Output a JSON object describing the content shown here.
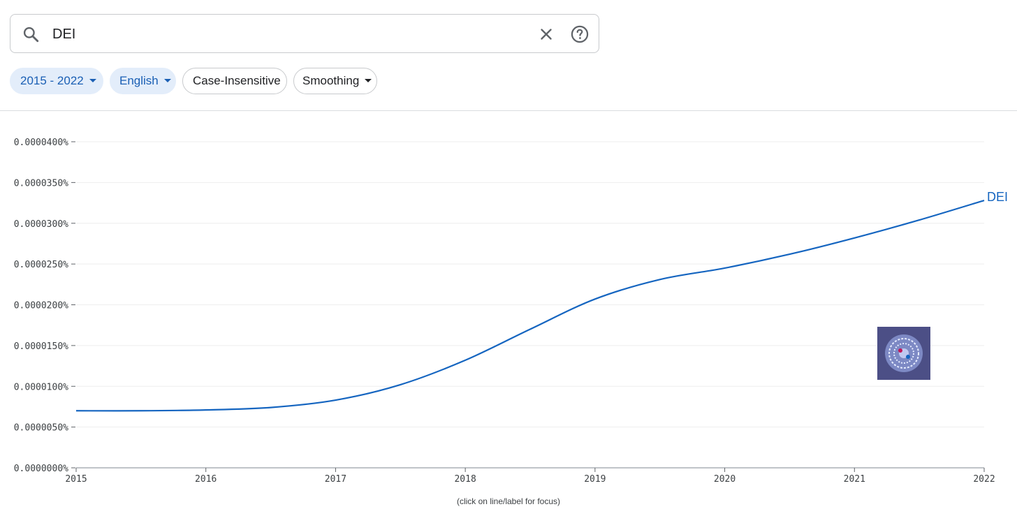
{
  "search": {
    "query": "DEI",
    "icon": "search-icon",
    "clear_icon": "close-icon",
    "help_icon": "help-circle-icon"
  },
  "filters": {
    "year_range": "2015 - 2022",
    "language": "English",
    "case": "Case-Insensitive",
    "smoothing": "Smoothing"
  },
  "colors": {
    "series": "#1565c0",
    "chip_active_bg": "#e3edfa",
    "chip_active_text": "#1a5fb4"
  },
  "footnote": "(click on line/label for focus)",
  "chart_data": {
    "type": "line",
    "x": [
      2015,
      2015.5,
      2016,
      2016.5,
      2017,
      2017.5,
      2018,
      2018.5,
      2019,
      2019.5,
      2020,
      2020.5,
      2021,
      2021.5,
      2022
    ],
    "series": [
      {
        "name": "DEI",
        "values": [
          7e-06,
          7e-06,
          7.1e-06,
          7.4e-06,
          8.3e-06,
          1.02e-05,
          1.32e-05,
          1.7e-05,
          2.07e-05,
          2.31e-05,
          2.45e-05,
          2.62e-05,
          2.82e-05,
          3.04e-05,
          3.28e-05
        ]
      }
    ],
    "xticks": [
      "2015",
      "2016",
      "2017",
      "2018",
      "2019",
      "2020",
      "2021",
      "2022"
    ],
    "yticks": [
      "0.0000000%",
      "0.0000050%",
      "0.0000100%",
      "0.0000150%",
      "0.0000200%",
      "0.0000250%",
      "0.0000300%",
      "0.0000350%",
      "0.0000400%"
    ],
    "ylim": [
      0,
      4e-05
    ],
    "xlim": [
      2015,
      2022
    ],
    "grid": true
  }
}
